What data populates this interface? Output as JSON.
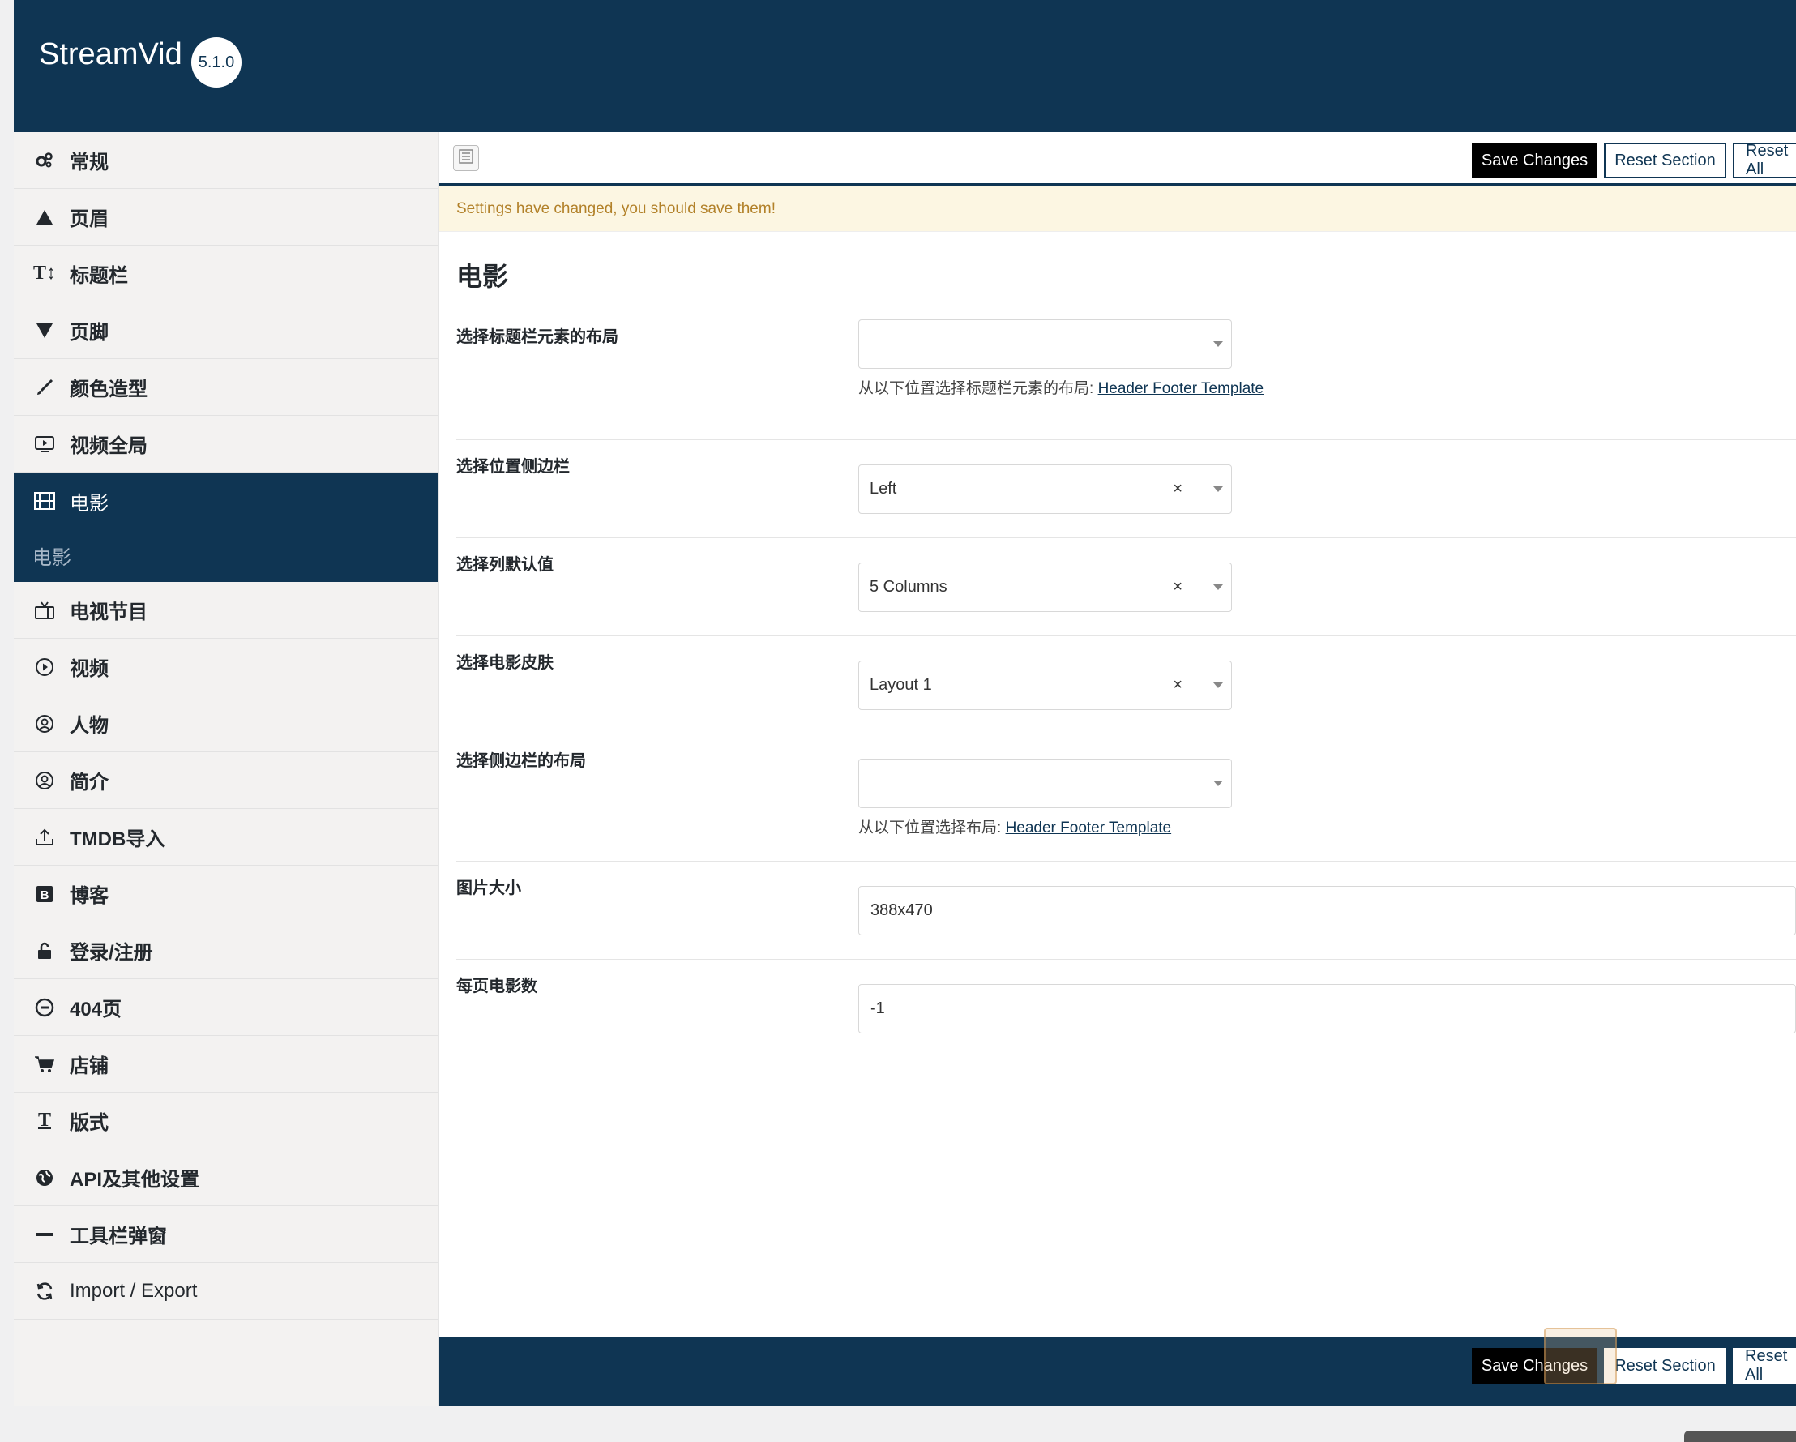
{
  "app": {
    "name": "StreamVid",
    "version": "5.1.0"
  },
  "sidebar": {
    "items": [
      {
        "label": "常规",
        "icon": "gears-icon"
      },
      {
        "label": "页眉",
        "icon": "triangle-up-icon"
      },
      {
        "label": "标题栏",
        "icon": "text-height-icon"
      },
      {
        "label": "页脚",
        "icon": "triangle-down-icon"
      },
      {
        "label": "颜色造型",
        "icon": "brush-icon"
      },
      {
        "label": "视频全局",
        "icon": "video-screen-icon"
      },
      {
        "label": "电影",
        "icon": "film-icon",
        "active": true,
        "sub": "电影"
      },
      {
        "label": "电视节目",
        "icon": "tv-icon"
      },
      {
        "label": "视频",
        "icon": "play-circle-icon"
      },
      {
        "label": "人物",
        "icon": "user-circle-icon"
      },
      {
        "label": "简介",
        "icon": "user-circle-icon"
      },
      {
        "label": "TMDB导入",
        "icon": "upload-icon"
      },
      {
        "label": "博客",
        "icon": "blog-icon"
      },
      {
        "label": "登录/注册",
        "icon": "unlock-icon"
      },
      {
        "label": "404页",
        "icon": "minus-circle-icon"
      },
      {
        "label": "店铺",
        "icon": "cart-icon"
      },
      {
        "label": "版式",
        "icon": "typography-icon"
      },
      {
        "label": "API及其他设置",
        "icon": "globe-icon"
      },
      {
        "label": "工具栏弹窗",
        "icon": "minus-icon"
      },
      {
        "label": "Import / Export",
        "icon": "refresh-icon"
      }
    ]
  },
  "toolbar": {
    "save_label": "Save Changes",
    "reset_section_label": "Reset Section",
    "reset_all_label": "Reset All"
  },
  "notice": "Settings have changed, you should save them!",
  "section": {
    "title": "电影",
    "fields": {
      "title_bar_layout": {
        "label": "选择标题栏元素的布局",
        "value": "",
        "desc_prefix": "从以下位置选择标题栏元素的布局:",
        "desc_link": "Header Footer Template"
      },
      "sidebar_position": {
        "label": "选择位置侧边栏",
        "value": "Left",
        "clear": "×"
      },
      "columns_default": {
        "label": "选择列默认值",
        "value": "5 Columns",
        "clear": "×"
      },
      "movie_skin": {
        "label": "选择电影皮肤",
        "value": "Layout 1",
        "clear": "×"
      },
      "sidebar_layout": {
        "label": "选择侧边栏的布局",
        "value": "",
        "desc_prefix": "从以下位置选择布局:",
        "desc_link": "Header Footer Template"
      },
      "image_size": {
        "label": "图片大小",
        "value": "388x470"
      },
      "movies_per_page": {
        "label": "每页电影数",
        "value": "-1"
      }
    }
  }
}
